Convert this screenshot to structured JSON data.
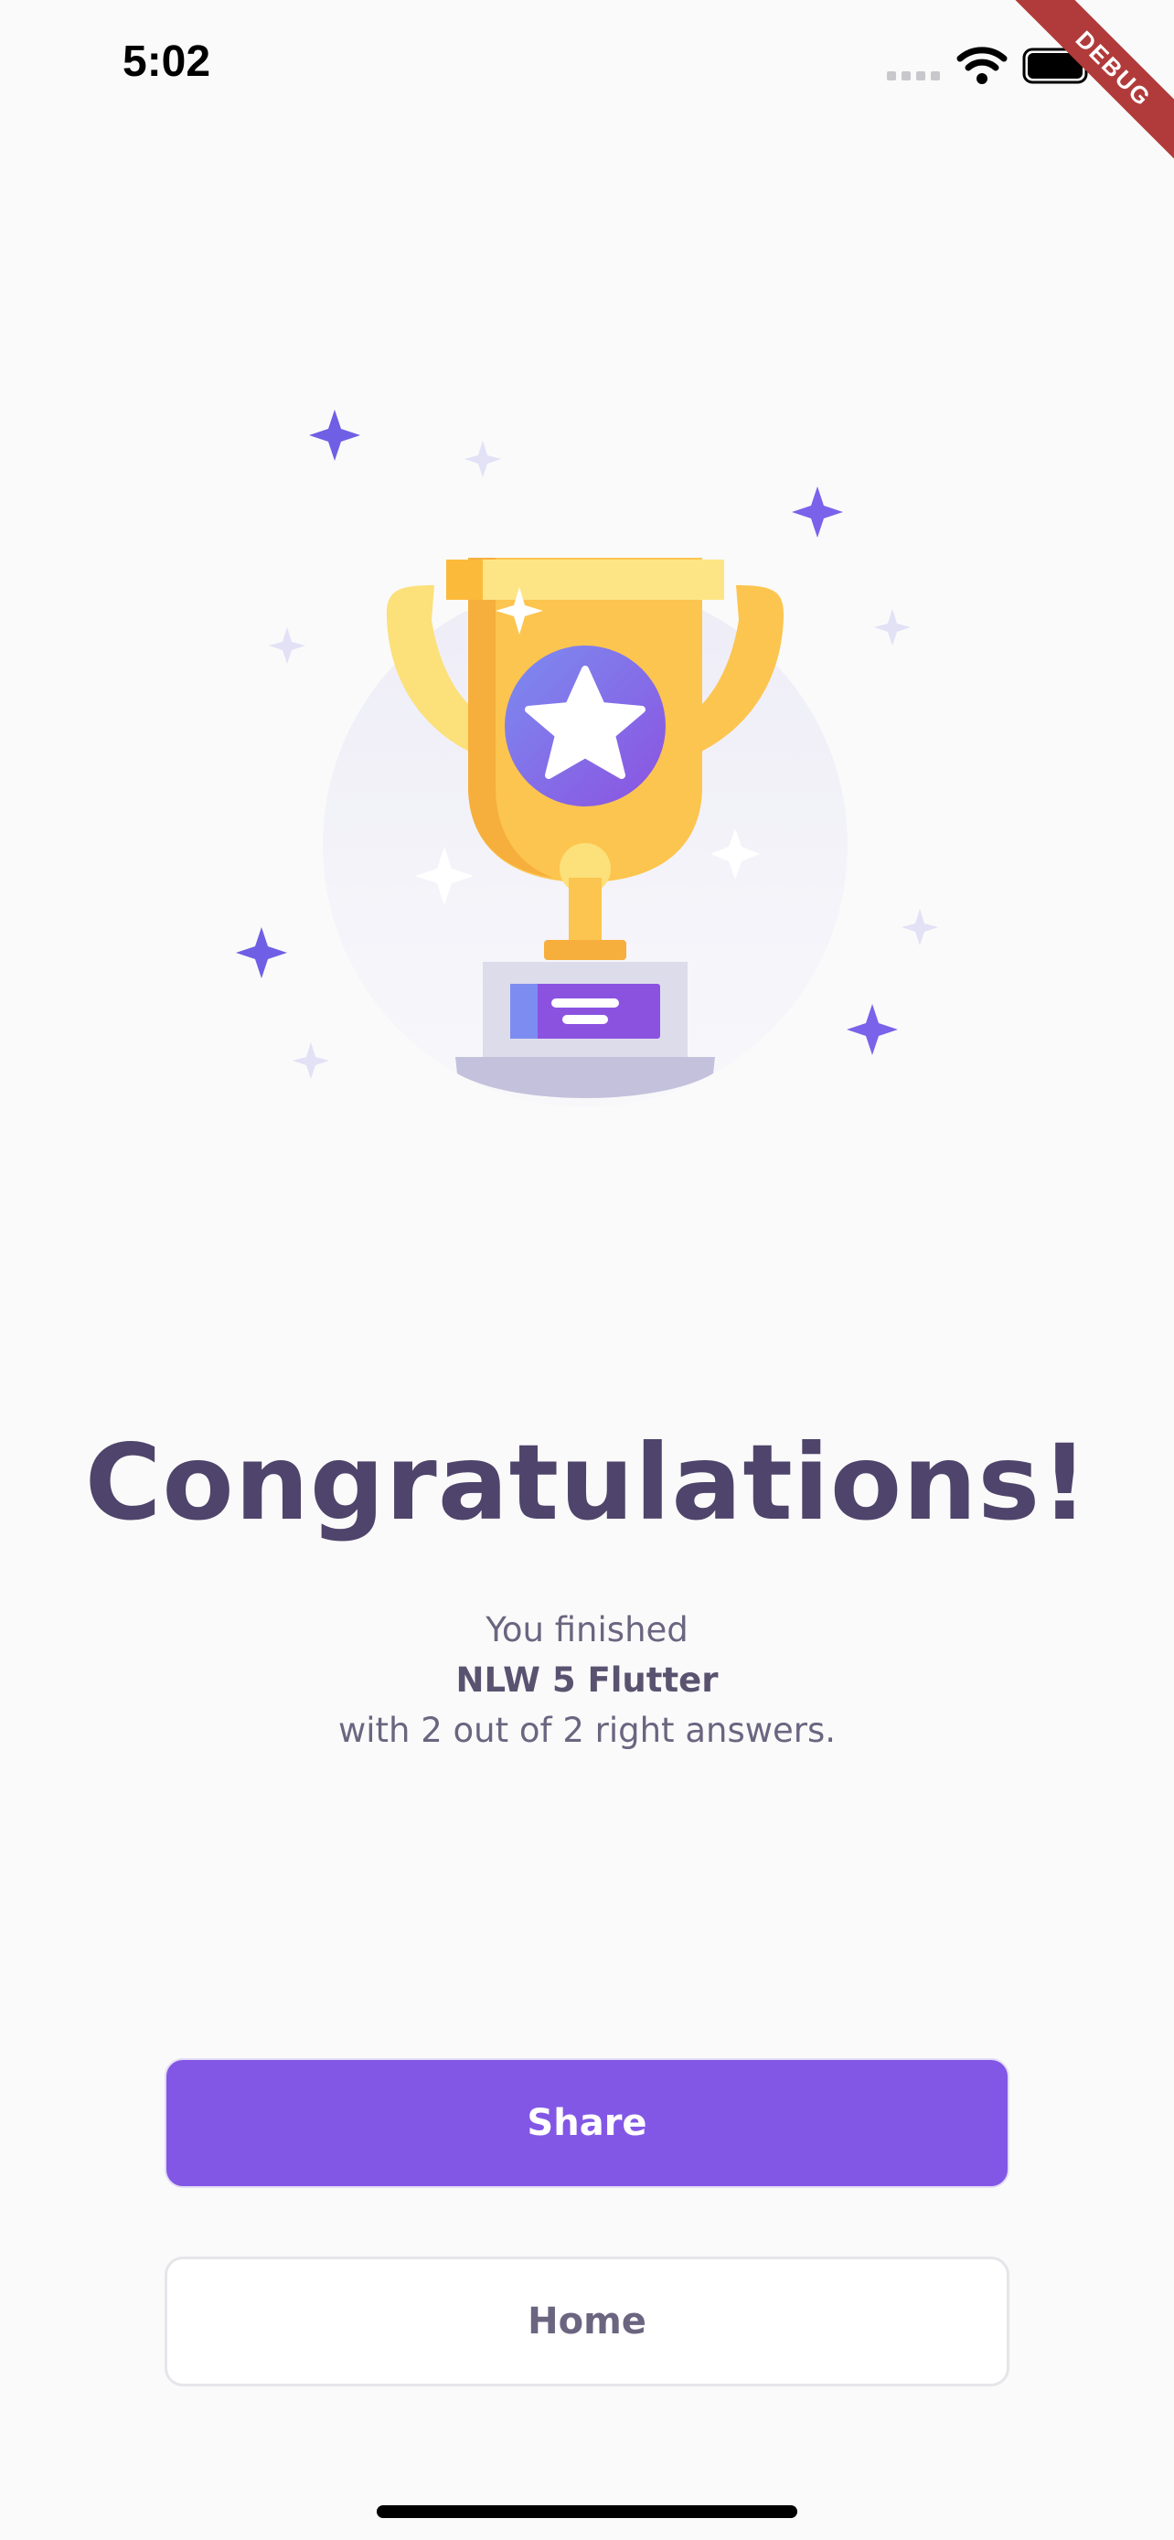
{
  "status_bar": {
    "time": "5:02",
    "icons": [
      "signal-icon",
      "wifi-icon",
      "battery-icon"
    ]
  },
  "debug_banner": {
    "label": "DEBUG",
    "color": "#B13B3B"
  },
  "illustration": {
    "icon": "trophy-icon"
  },
  "result": {
    "title": "Congratulations!",
    "line1": "You finished",
    "quiz_name": "NLW 5 Flutter",
    "line3": "with 2 out of 2 right answers."
  },
  "buttons": {
    "share": "Share",
    "home": "Home"
  },
  "colors": {
    "primary": "#8257E5",
    "title": "#4F446B",
    "body_text": "#6B6580",
    "background": "#FAFAFA",
    "trophy_gold": "#FCC54F"
  }
}
